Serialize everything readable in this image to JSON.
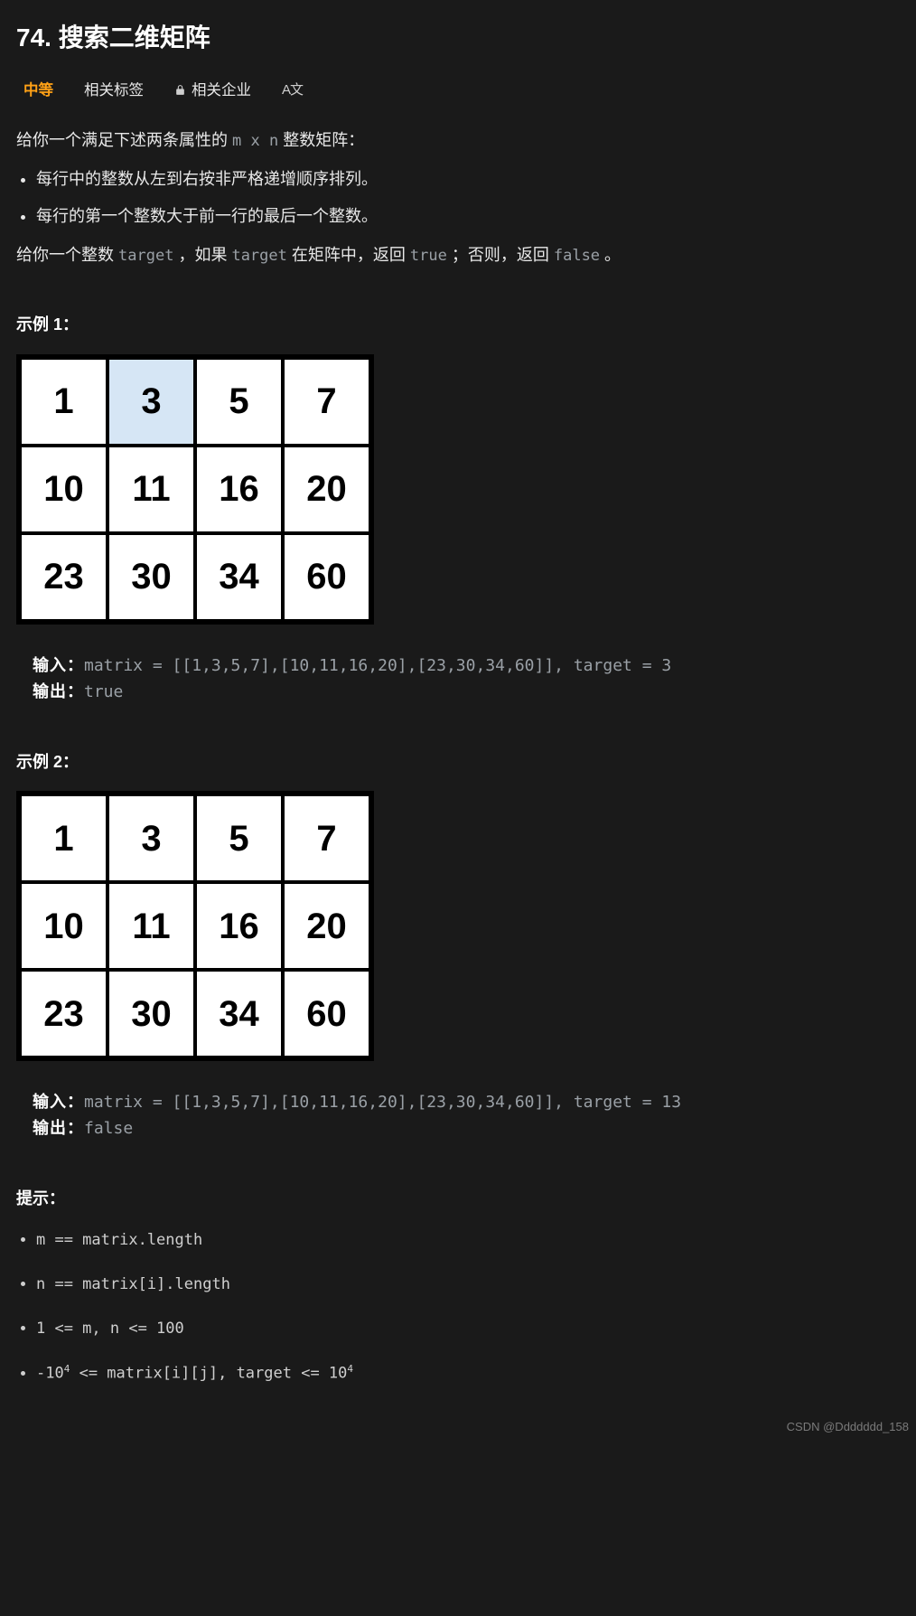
{
  "title": "74. 搜索二维矩阵",
  "tabs": {
    "difficulty": "中等",
    "tags": "相关标签",
    "companies": "相关企业",
    "translate": "A文"
  },
  "desc": {
    "intro_pre": "给你一个满足下述两条属性的 ",
    "intro_code": "m x n",
    "intro_post": " 整数矩阵：",
    "bullets": [
      "每行中的整数从左到右按非严格递增顺序排列。",
      "每行的第一个整数大于前一行的最后一个整数。"
    ],
    "p2_a": "给你一个整数 ",
    "p2_code1": "target",
    "p2_b": " ，如果 ",
    "p2_code2": "target",
    "p2_c": " 在矩阵中，返回 ",
    "p2_code3": "true",
    "p2_d": " ；否则，返回 ",
    "p2_code4": "false",
    "p2_e": " 。"
  },
  "example1": {
    "label": "示例 1：",
    "matrix": [
      [
        1,
        3,
        5,
        7
      ],
      [
        10,
        11,
        16,
        20
      ],
      [
        23,
        30,
        34,
        60
      ]
    ],
    "highlight": [
      0,
      1
    ],
    "input_label": "输入：",
    "input_val": "matrix = [[1,3,5,7],[10,11,16,20],[23,30,34,60]], target = 3",
    "output_label": "输出：",
    "output_val": "true"
  },
  "example2": {
    "label": "示例 2：",
    "matrix": [
      [
        1,
        3,
        5,
        7
      ],
      [
        10,
        11,
        16,
        20
      ],
      [
        23,
        30,
        34,
        60
      ]
    ],
    "highlight": null,
    "input_label": "输入：",
    "input_val": "matrix = [[1,3,5,7],[10,11,16,20],[23,30,34,60]], target = 13",
    "output_label": "输出：",
    "output_val": "false"
  },
  "hints": {
    "label": "提示：",
    "items_html": [
      "m == matrix.length",
      "n == matrix[i].length",
      "1 <= m, n <= 100",
      "-10<sup>4</sup> <= matrix[i][j], target <= 10<sup>4</sup>"
    ]
  },
  "watermark": "CSDN @Ddddddd_158"
}
